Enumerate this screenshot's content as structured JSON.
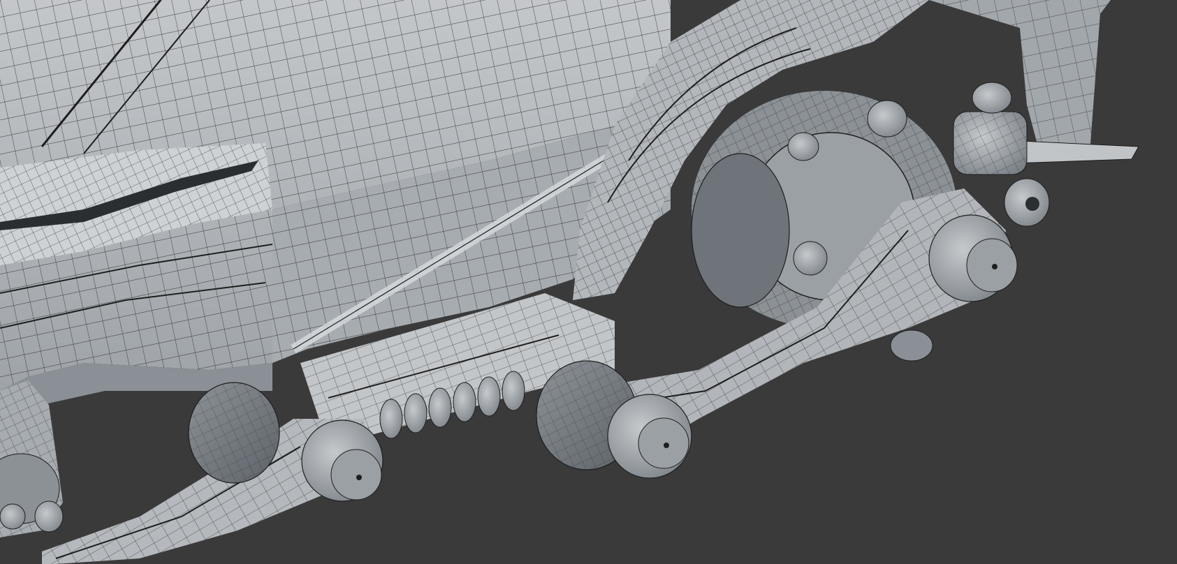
{
  "scene": {
    "background_color": "#3a3a3a",
    "mesh_fill_color": "#b9bdc1",
    "mesh_shadow_color": "#7f858b",
    "wire_color": "#1c1c1c",
    "subject": "wireframe-mesh-render"
  }
}
